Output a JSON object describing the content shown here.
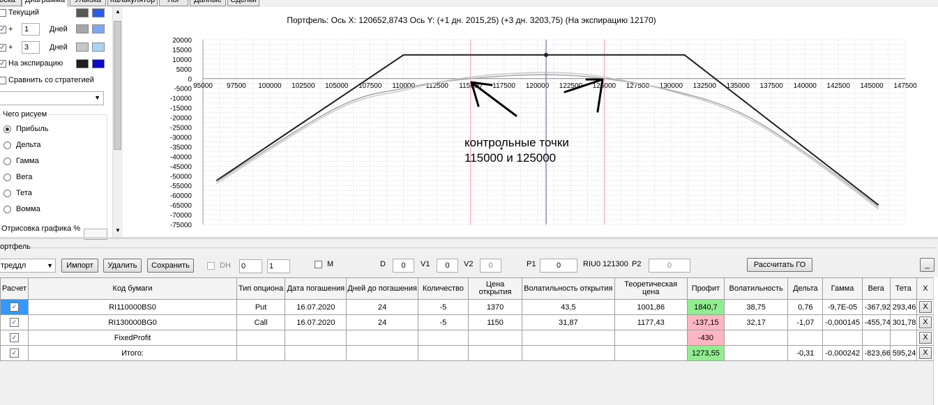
{
  "tabs": [
    "оска",
    "Диаграмма",
    "Улыбка",
    "Калькулятор",
    "Лог",
    "Данные",
    "Сделки"
  ],
  "left": {
    "current_label": "Текущий",
    "plus_label": "+",
    "days_label": "Дней",
    "day1_value": "1",
    "day2_value": "3",
    "expiry_label": "На экспирацию",
    "compare_label": "Сравнить со стратегией",
    "draw_group_label": "Чего рисуем",
    "radios": [
      "Прибыль",
      "Дельта",
      "Гамма",
      "Вега",
      "Тета",
      "Вомма"
    ],
    "render_label": "Отрисовка графика %",
    "colors": {
      "current": [
        "#595959",
        "#2d5de8"
      ],
      "day1": [
        "#a6a6a6",
        "#7fa6f2"
      ],
      "day3": [
        "#c8c8c8",
        "#aad4f7"
      ],
      "expiry": [
        "#1e1e1e",
        "#0a0ac8"
      ]
    }
  },
  "chart_header": {
    "title": "Портфель:",
    "x_label": "Ось X:",
    "x_value": "120652,8743",
    "y_label": "Ось Y:",
    "d1": "(+1 дн. 2015,25)",
    "d3": "(+3 дн. 3203,75)",
    "exp": "(На экспирацию 12170)"
  },
  "annotation": [
    "контрольные точки",
    "115000 и 125000"
  ],
  "chart_data": {
    "type": "line",
    "xlim": [
      95000,
      147500
    ],
    "ylim": [
      -75000,
      20000
    ],
    "x_ticks": [
      95000,
      97500,
      100000,
      102500,
      105000,
      107500,
      110000,
      112500,
      115000,
      117500,
      120000,
      122500,
      125000,
      127500,
      130000,
      132500,
      135000,
      137500,
      140000,
      142500,
      145000,
      147500
    ],
    "y_ticks": [
      20000,
      15000,
      10000,
      5000,
      0,
      -5000,
      -10000,
      -15000,
      -20000,
      -25000,
      -30000,
      -35000,
      -40000,
      -45000,
      -50000,
      -55000,
      -60000,
      -65000,
      -70000,
      -75000
    ],
    "vlines": {
      "pink": [
        115000,
        125000
      ],
      "blue": [
        120652.87
      ]
    },
    "series": [
      {
        "color": "#1e1e1e",
        "x": [
          96000,
          110000,
          130000,
          131000,
          145500
        ],
        "y": [
          -52500,
          12170,
          12170,
          12170,
          -65000
        ]
      },
      {
        "color": "#a6a6a6",
        "x": [
          96000,
          105000,
          110000,
          115000,
          120650,
          125000,
          130000,
          135000,
          140000,
          145500
        ],
        "y": [
          -53000,
          -15000,
          -5000,
          0,
          2015,
          0,
          -6000,
          -17000,
          -38000,
          -66000
        ]
      },
      {
        "color": "#c8c8c8",
        "x": [
          96000,
          105000,
          110000,
          115000,
          120650,
          125000,
          130000,
          135000,
          140000,
          145500
        ],
        "y": [
          -54000,
          -16000,
          -6000,
          800,
          3204,
          800,
          -6500,
          -18000,
          -39000,
          -67000
        ]
      }
    ]
  },
  "portfolio": {
    "section_label": "ортфель",
    "strategy_value": "треддл",
    "import_label": "Импорт",
    "delete_label": "Удалить",
    "save_label": "Сохранить",
    "dh_label": "DH",
    "spin1": "0",
    "spin2": "1",
    "m_label": "M",
    "d_label": "D",
    "d_value": "0",
    "v1_label": "V1",
    "v1_value": "0",
    "v2_label": "V2",
    "v2_value": "0",
    "p1_label": "P1",
    "p1_value": "0",
    "riu_label": "RIU0 121300",
    "p2_label": "P2",
    "p2_value": "0",
    "calc_go_label": "Рассчитать ГО",
    "min_label": "_"
  },
  "table": {
    "headers": [
      "Расчет",
      "Код бумаги",
      "Тип опциона",
      "Дата погашения",
      "Дней до погашения",
      "Количество",
      "Цена открытия",
      "Волатильность открытия",
      "Теоретическая цена",
      "Профит",
      "Волатильность",
      "Дельта",
      "Гамма",
      "Вега",
      "Тета",
      "X"
    ],
    "rows": [
      [
        "",
        "RI110000BS0",
        "Put",
        "16.07.2020",
        "24",
        "-5",
        "1370",
        "43,5",
        "1001,86",
        "1840,7",
        "38,75",
        "0,76",
        "-9,7E-05",
        "-367,92",
        "293,46",
        "X"
      ],
      [
        "",
        "RI130000BG0",
        "Call",
        "16.07.2020",
        "24",
        "-5",
        "1150",
        "31,87",
        "1177,43",
        "-137,15",
        "32,17",
        "-1,07",
        "-0,000145",
        "-455,74",
        "301,78",
        "X"
      ],
      [
        "",
        "FixedProfit",
        "",
        "",
        "",
        "",
        "",
        "",
        "",
        "-430",
        "",
        "",
        "",
        "",
        "",
        "X"
      ],
      [
        "",
        "Итого:",
        "",
        "",
        "",
        "",
        "",
        "",
        "",
        "1273,55",
        "",
        "-0,31",
        "-0,000242",
        "-823,66",
        "595,24",
        "X"
      ]
    ],
    "profit_colors": [
      "#90ee90",
      "#ffb6c1",
      "#ffb6c1",
      "#90ee90"
    ]
  }
}
